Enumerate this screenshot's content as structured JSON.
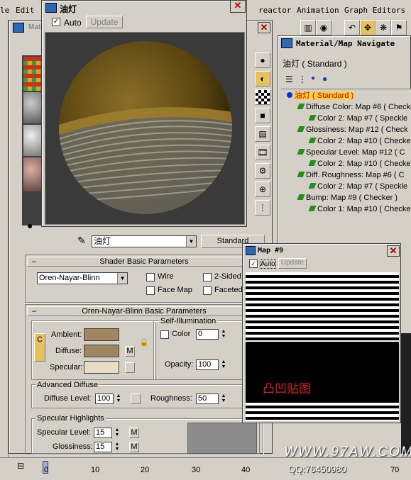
{
  "menubar": {
    "items": [
      "le",
      "Edit",
      "reactor",
      "Animation",
      "Graph Editors"
    ]
  },
  "preview_window": {
    "title": "油灯",
    "auto_label": "Auto",
    "auto_checked": true,
    "update_label": "Update",
    "close_glyph": "✕"
  },
  "material_editor": {
    "title": "Mater",
    "material_name": "油灯",
    "material_type": "Standard",
    "shader_rollout": {
      "title": "Shader Basic Parameters",
      "shader": "Oren-Nayar-Blinn",
      "wire": "Wire",
      "two_sided": "2-Sided",
      "face_map": "Face Map",
      "faceted": "Faceted"
    },
    "basic_rollout": {
      "title": "Oren-Nayar-Blinn Basic Parameters",
      "ambient": "Ambient:",
      "diffuse": "Diffuse:",
      "specular": "Specular:",
      "map_btn": "M",
      "lock_btn": "C",
      "self_illum_title": "Self-Illumination",
      "color_label": "Color",
      "color_value": "0",
      "opacity_label": "Opacity:",
      "opacity_value": "100",
      "adv_diffuse_title": "Advanced Diffuse",
      "diffuse_level_label": "Diffuse Level:",
      "diffuse_level_value": "100",
      "roughness_label": "Roughness:",
      "roughness_value": "50",
      "spec_highlights_title": "Specular Highlights",
      "spec_level_label": "Specular Level:",
      "spec_level_value": "15",
      "glossiness_label": "Glossiness:",
      "glossiness_value": "15"
    },
    "colors": {
      "ambient": "#a08660",
      "diffuse": "#a08660",
      "specular": "#e8dcc4"
    }
  },
  "navigator": {
    "title": "Material/Map Navigate",
    "header": "油灯 ( Standard )",
    "items": [
      {
        "label": "油灯 ( Standard )",
        "level": 0,
        "selected": true
      },
      {
        "label": "Diffuse Color: Map #6 ( Checke",
        "level": 1
      },
      {
        "label": "Color 2: Map #7 ( Speckle",
        "level": 2
      },
      {
        "label": "Glossiness: Map #12 ( Check",
        "level": 1
      },
      {
        "label": "Color 2: Map #10 ( Checke",
        "level": 2
      },
      {
        "label": "Specular Level: Map #12 ( C",
        "level": 1
      },
      {
        "label": "Color 2: Map #10 ( Checke",
        "level": 2
      },
      {
        "label": "Diff. Roughness: Map #6 ( C",
        "level": 1
      },
      {
        "label": "Color 2: Map #7 ( Speckle",
        "level": 2
      },
      {
        "label": "Bump: Map #9 ( Checker )",
        "level": 1
      },
      {
        "label": "Color 1: Map #10 ( Checke",
        "level": 2
      }
    ]
  },
  "map_window": {
    "title": "Map #9",
    "auto_label": "Auto",
    "update_label": "Update",
    "caption": "凸凹贴图",
    "close_glyph": "✕"
  },
  "timeline": {
    "ticks": [
      "0",
      "10",
      "20",
      "30",
      "40",
      "70"
    ]
  },
  "watermark": {
    "site": "WWW.97AW.COM",
    "qq": "QQ:76450980"
  }
}
